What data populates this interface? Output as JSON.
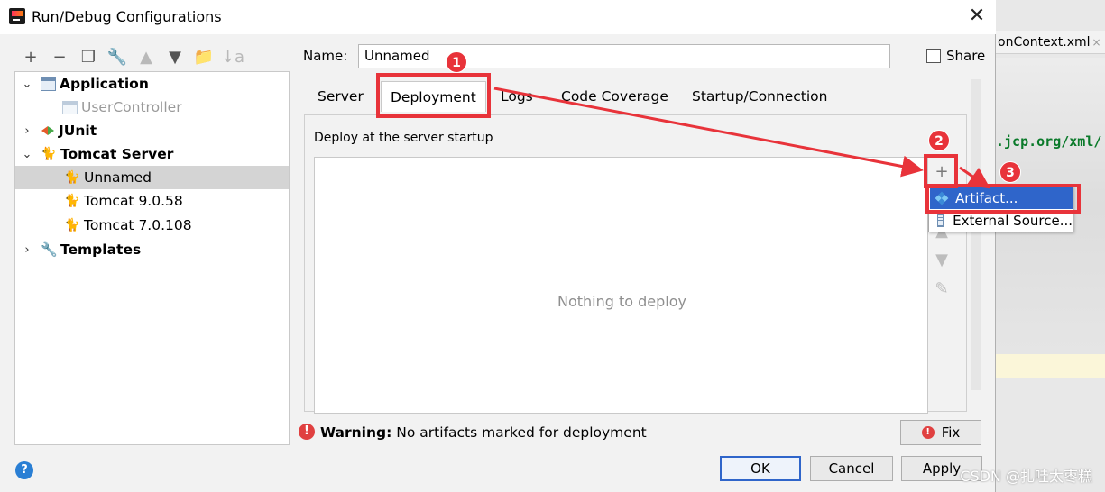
{
  "editor_bg": {
    "tab_label": "onContext.xml",
    "tab_close": "×",
    "code_text": ".jcp.org/xml/",
    "watermark": "CSDN @扎哇太枣糕"
  },
  "window": {
    "title": "Run/Debug Configurations",
    "close_glyph": "✕"
  },
  "toolbar": {
    "add": "+",
    "remove": "−",
    "copy": "❐",
    "edit_defaults": "🔧",
    "move_up": "▲",
    "move_down": "▼",
    "folder": "📁",
    "sort": "↓a"
  },
  "tree": {
    "application": "Application",
    "user_controller": "UserController",
    "junit": "JUnit",
    "tomcat_server": "Tomcat Server",
    "unnamed": "Unnamed",
    "tomcat_9": "Tomcat 9.0.58",
    "tomcat_7": "Tomcat 7.0.108",
    "templates": "Templates",
    "expanded_glyph": "⌄",
    "collapsed_glyph": "›"
  },
  "form": {
    "name_label": "Name:",
    "name_value": "Unnamed",
    "share_label": "Share"
  },
  "tabs": [
    "Server",
    "Deployment",
    "Logs",
    "Code Coverage",
    "Startup/Connection"
  ],
  "deployment": {
    "section_title": "Deploy at the server startup",
    "empty_text": "Nothing to deploy",
    "add_glyph": "+",
    "up_glyph": "▲",
    "down_glyph": "▼",
    "edit_glyph": "✎"
  },
  "popup": {
    "items": [
      "Artifact...",
      "External Source..."
    ]
  },
  "warning": {
    "icon": "!",
    "prefix": "Warning:",
    "message": " No artifacts marked for deployment"
  },
  "buttons": {
    "fix": "Fix",
    "ok": "OK",
    "cancel": "Cancel",
    "apply": "Apply",
    "help": "?"
  },
  "annotations": {
    "badge_1": "1",
    "badge_2": "2",
    "badge_3": "3",
    "color": "#e8333a"
  }
}
